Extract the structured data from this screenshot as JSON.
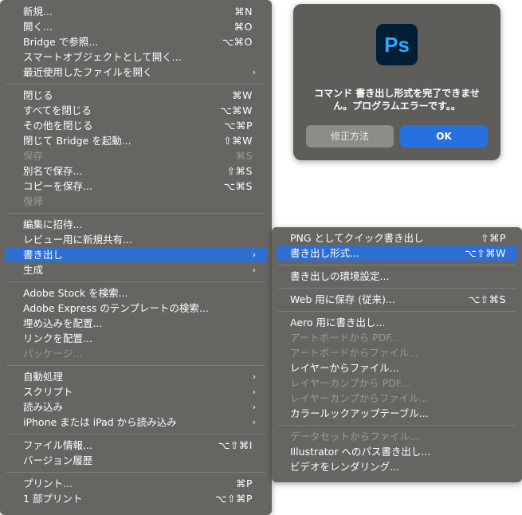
{
  "file_menu": {
    "groups": [
      [
        {
          "label": "新規...",
          "shortcut": "⌘N"
        },
        {
          "label": "開く...",
          "shortcut": "⌘O"
        },
        {
          "label": "Bridge で参照...",
          "shortcut": "⌥⌘O"
        },
        {
          "label": "スマートオブジェクトとして開く...",
          "shortcut": ""
        },
        {
          "label": "最近使用したファイルを開く",
          "shortcut": "",
          "submenu": true
        }
      ],
      [
        {
          "label": "閉じる",
          "shortcut": "⌘W"
        },
        {
          "label": "すべてを閉じる",
          "shortcut": "⌥⌘W"
        },
        {
          "label": "その他を閉じる",
          "shortcut": "⌥⌘P"
        },
        {
          "label": "閉じて Bridge を起動...",
          "shortcut": "⇧⌘W"
        },
        {
          "label": "保存",
          "shortcut": "⌘S",
          "disabled": true
        },
        {
          "label": "別名で保存...",
          "shortcut": "⇧⌘S"
        },
        {
          "label": "コピーを保存...",
          "shortcut": "⌥⌘S"
        },
        {
          "label": "復帰",
          "shortcut": "",
          "disabled": true
        }
      ],
      [
        {
          "label": "編集に招待...",
          "shortcut": ""
        },
        {
          "label": "レビュー用に新規共有...",
          "shortcut": ""
        },
        {
          "label": "書き出し",
          "shortcut": "",
          "submenu": true,
          "highlight": true
        },
        {
          "label": "生成",
          "shortcut": "",
          "submenu": true
        }
      ],
      [
        {
          "label": "Adobe Stock を検索...",
          "shortcut": ""
        },
        {
          "label": "Adobe Express のテンプレートの検索...",
          "shortcut": ""
        },
        {
          "label": "埋め込みを配置...",
          "shortcut": ""
        },
        {
          "label": "リンクを配置...",
          "shortcut": ""
        },
        {
          "label": "パッケージ...",
          "shortcut": "",
          "disabled": true
        }
      ],
      [
        {
          "label": "自動処理",
          "shortcut": "",
          "submenu": true
        },
        {
          "label": "スクリプト",
          "shortcut": "",
          "submenu": true
        },
        {
          "label": "読み込み",
          "shortcut": "",
          "submenu": true
        },
        {
          "label": "iPhone または iPad から読み込み",
          "shortcut": "",
          "submenu": true
        }
      ],
      [
        {
          "label": "ファイル情報...",
          "shortcut": "⌥⇧⌘I"
        },
        {
          "label": "バージョン履歴",
          "shortcut": ""
        }
      ],
      [
        {
          "label": "プリント...",
          "shortcut": "⌘P"
        },
        {
          "label": "1 部プリント",
          "shortcut": "⌥⇧⌘P"
        }
      ]
    ]
  },
  "export_menu": {
    "groups": [
      [
        {
          "label": "PNG としてクイック書き出し",
          "shortcut": "⇧⌘P"
        },
        {
          "label": "書き出し形式...",
          "shortcut": "⌥⇧⌘W",
          "highlight": true
        }
      ],
      [
        {
          "label": "書き出しの環境設定...",
          "shortcut": ""
        }
      ],
      [
        {
          "label": "Web 用に保存 (従来)...",
          "shortcut": "⌥⇧⌘S"
        }
      ],
      [
        {
          "label": "Aero 用に書き出し...",
          "shortcut": ""
        },
        {
          "label": "アートボードから PDF...",
          "shortcut": "",
          "disabled": true
        },
        {
          "label": "アートボードからファイル...",
          "shortcut": "",
          "disabled": true
        },
        {
          "label": "レイヤーからファイル...",
          "shortcut": ""
        },
        {
          "label": "レイヤーカンプから PDF...",
          "shortcut": "",
          "disabled": true
        },
        {
          "label": "レイヤーカンプからファイル...",
          "shortcut": "",
          "disabled": true
        },
        {
          "label": "カラールックアップテーブル...",
          "shortcut": ""
        }
      ],
      [
        {
          "label": "データセットからファイル...",
          "shortcut": "",
          "disabled": true
        },
        {
          "label": "Illustrator へのパス書き出し...",
          "shortcut": ""
        },
        {
          "label": "ビデオをレンダリング...",
          "shortcut": ""
        }
      ]
    ]
  },
  "dialog": {
    "logo_text": "Ps",
    "message": "コマンド 書き出し形式を完了できません。プログラムエラーです。。",
    "fix_button": "修正方法",
    "ok_button": "OK"
  },
  "colors": {
    "menu_bg": "#676561",
    "highlight": "#2d6fd3",
    "ok": "#2670e0",
    "ps_bg": "#001e36",
    "ps_text": "#31a8ff"
  }
}
